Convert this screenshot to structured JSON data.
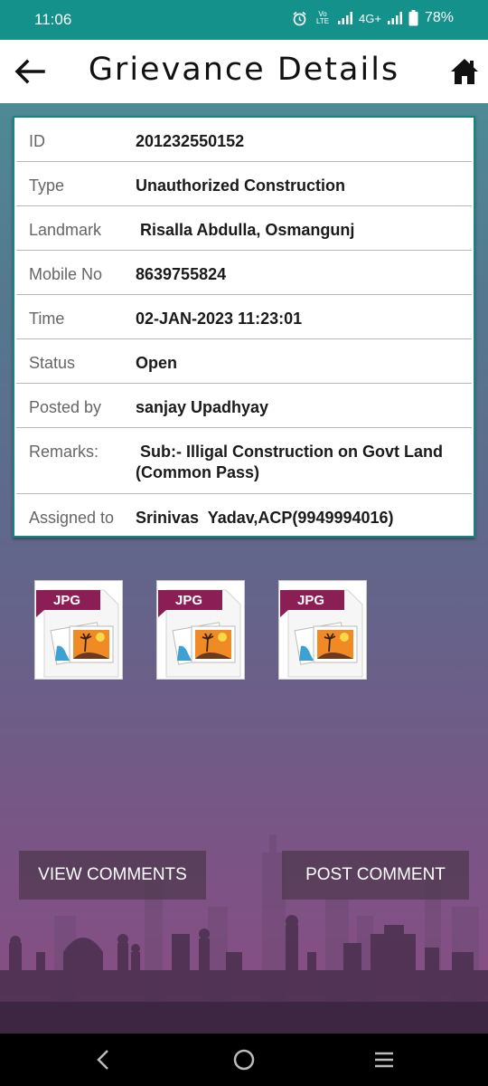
{
  "status_bar": {
    "time": "11:06",
    "net_label": "Vo LTE",
    "network": "4G+",
    "battery": "78%"
  },
  "app_bar": {
    "title": "Grievance Details",
    "back_icon": "arrow-left-icon",
    "home_icon": "home-icon"
  },
  "details": [
    {
      "label": "ID",
      "value": "201232550152"
    },
    {
      "label": "Type",
      "value": "Unauthorized Construction"
    },
    {
      "label": "Landmark",
      "value": " Risalla Abdulla, Osmangunj"
    },
    {
      "label": "Mobile No",
      "value": "8639755824"
    },
    {
      "label": "Time",
      "value": "02-JAN-2023 11:23:01"
    },
    {
      "label": "Status",
      "value": "Open"
    },
    {
      "label": "Posted by",
      "value": "sanjay Upadhyay"
    },
    {
      "label": "Remarks:",
      "value": " Sub:- Illigal Construction on Govt Land (Common Pass)"
    },
    {
      "label": "Assigned to",
      "value": "Srinivas  Yadav,ACP(9949994016)"
    }
  ],
  "attachments": [
    {
      "label": "JPG"
    },
    {
      "label": "JPG"
    },
    {
      "label": "JPG"
    }
  ],
  "buttons": {
    "view_comments": "VIEW COMMENTS",
    "post_comment": "POST COMMENT"
  },
  "colors": {
    "status_bar": "#15918c",
    "card_border": "#16857f",
    "button_bg": "#553c55"
  }
}
